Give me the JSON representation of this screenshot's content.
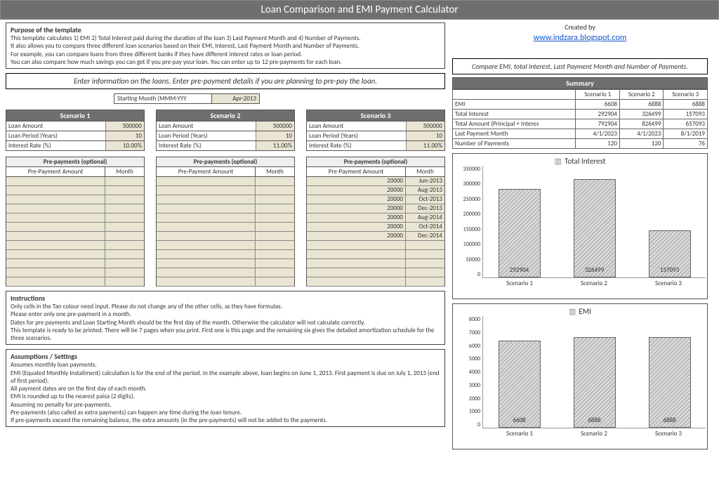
{
  "title": "Loan Comparison and EMI Payment Calculator",
  "created_by": "Created by",
  "link": "www.indzara.blogspot.com",
  "purpose": {
    "heading": "Purpose of the template",
    "l1": "This template calculates 1) EMI 2) Total Interest paid during the duration of the loan 3) Last Payment Month and 4) Number of Payments.",
    "l2": "It also allows you to compare three different loan scenarios based on their EMI, Interest, Last Payment Month and Number of Payments.",
    "l3": "For example, you can compare loans from three different banks if they have different interest rates or loan period.",
    "l4": "You can also compare how much savings you can get if you pre-pay your loan. You can enter up to 12 pre-payments for each loan."
  },
  "enter_info": "Enter information on the loans. Enter pre-payment details if you are planning to pre-pay the loan.",
  "compare_info": "Compare EMI, total interest, Last Payment Month and Number of Payments.",
  "starting_month": {
    "label": "Starting Month (MMM-YYY",
    "value": "Apr-2013"
  },
  "fields": {
    "amount": "Loan Amount",
    "period": "Loan Period (Years)",
    "rate": "Interest Rate (%)"
  },
  "scn": [
    {
      "name": "Scenario 1",
      "amount": "500000",
      "period": "10",
      "rate": "10.00%"
    },
    {
      "name": "Scenario 2",
      "amount": "500000",
      "period": "10",
      "rate": "11.00%"
    },
    {
      "name": "Scenario 3",
      "amount": "500000",
      "period": "10",
      "rate": "11.00%"
    }
  ],
  "pp": {
    "title": "Pre-payments (optional)",
    "amt_hdr": "Pre-Payment Amount",
    "mo_hdr": "Month",
    "s3": [
      {
        "a": "20000",
        "m": "Jun-2013"
      },
      {
        "a": "20000",
        "m": "Aug-2013"
      },
      {
        "a": "20000",
        "m": "Oct-2013"
      },
      {
        "a": "20000",
        "m": "Dec-2013"
      },
      {
        "a": "20000",
        "m": "Aug-2014"
      },
      {
        "a": "20000",
        "m": "Oct-2014"
      },
      {
        "a": "20000",
        "m": "Dec-2014"
      }
    ]
  },
  "summary": {
    "title": "Summary",
    "cols": [
      "Scenario 1",
      "Scenario 2",
      "Scenario 3"
    ],
    "rows": [
      {
        "k": "EMI",
        "v": [
          "6608",
          "6888",
          "6888"
        ]
      },
      {
        "k": "Total Interest",
        "v": [
          "292904",
          "326499",
          "157093"
        ]
      },
      {
        "k": "Total Amount (Principal + Interes",
        "v": [
          "792904",
          "826499",
          "657093"
        ]
      },
      {
        "k": "Last Payment Month",
        "v": [
          "4/1/2023",
          "4/1/2023",
          "8/1/2019"
        ]
      },
      {
        "k": "Number of Payments",
        "v": [
          "120",
          "120",
          "76"
        ]
      }
    ]
  },
  "instructions": {
    "heading": "Instructions",
    "l1": "Only cells in the Tan colour need input. Please do not change any of the other cells, as they have formulas.",
    "l2": "Please enter only one pre-payment in a  month.",
    "l3": "Dates for pre payments and Loan Starting Month should be the first day of the month. Otherwise the calculator will not calculate correctly.",
    "l4": "This template is ready to be printed. There will be 7 pages when you print. First one is this page and the remaining six gives the detailed amortization schedule for the three scenarios."
  },
  "assumptions": {
    "heading": "Assumptions / Settings",
    "l1": "Assumes monthly loan payments.",
    "l2": "EMI (Equated Monthly Installment) calculation is for the end of the period. In the example above, loan begins on June 1, 2013. First payment is due on July 1, 2013 (end of first period).",
    "l3": "All payment dates are on the first day of each month.",
    "l4": "EMI is rounded up to the nearest paisa (2 digits).",
    "l5": "Assuming no penalty for pre-payments.",
    "l6": "Pre-payments (also called as extra payments) can happen any time during the loan tenure.",
    "l7": "If pre-payments exceed the remaining balance, the extra amounts (in the pre-payments) will not be added to the payments."
  },
  "chart_data": [
    {
      "type": "bar",
      "title": "Total Interest",
      "categories": [
        "Scenario 1",
        "Scenario 2",
        "Scenario 3"
      ],
      "values": [
        292904,
        326499,
        157093
      ],
      "ylim": [
        0,
        350000
      ],
      "yticks": [
        0,
        50000,
        100000,
        150000,
        200000,
        250000,
        300000,
        350000
      ]
    },
    {
      "type": "bar",
      "title": "EMI",
      "categories": [
        "Scenario 1",
        "Scenario 2",
        "Scenario 3"
      ],
      "values": [
        6608,
        6888,
        6888
      ],
      "ylim": [
        0,
        8000
      ],
      "yticks": [
        0,
        1000,
        2000,
        3000,
        4000,
        5000,
        6000,
        7000,
        8000
      ]
    }
  ]
}
